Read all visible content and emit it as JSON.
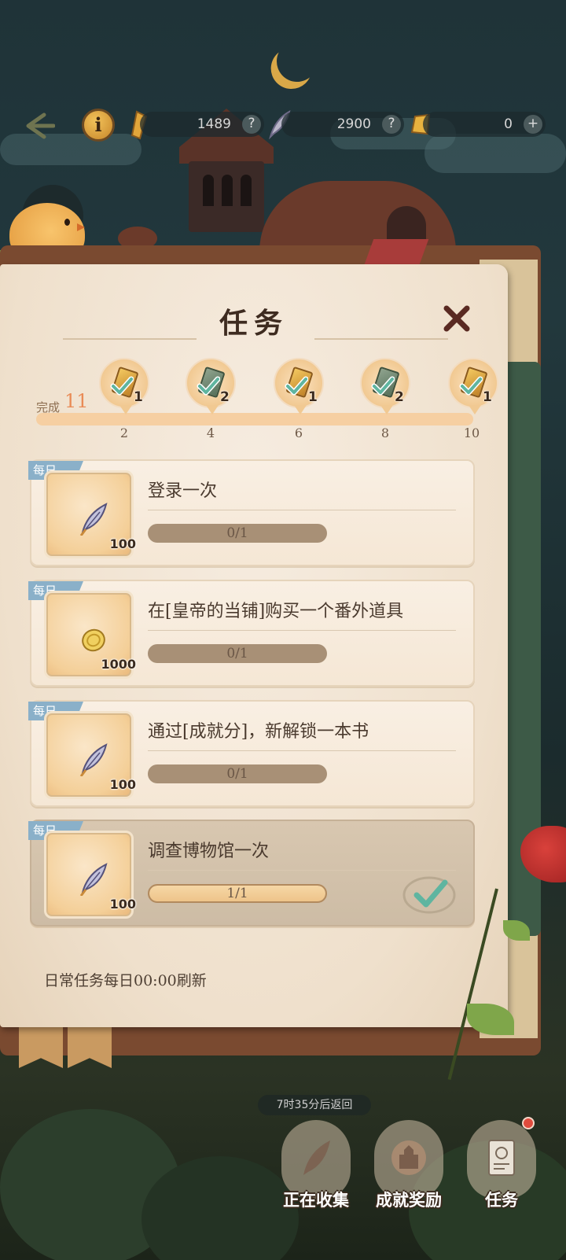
{
  "hud": {
    "info_label": "i",
    "resources": [
      {
        "name": "gold-quill",
        "value": "1489",
        "action": "?"
      },
      {
        "name": "feather",
        "value": "2900",
        "action": "?"
      },
      {
        "name": "coin",
        "value": "0",
        "action": "+"
      }
    ]
  },
  "panel": {
    "title": "任务",
    "progress": {
      "done_label": "完成",
      "done_count": "11",
      "fill_fraction": 1.0,
      "ticks": [
        "2",
        "4",
        "6",
        "8",
        "10"
      ],
      "milestones": [
        {
          "reward": "gold-book",
          "qty": "1",
          "claimed": true
        },
        {
          "reward": "green-book",
          "qty": "2",
          "claimed": true
        },
        {
          "reward": "gold-book",
          "qty": "1",
          "claimed": true
        },
        {
          "reward": "green-book",
          "qty": "2",
          "claimed": true
        },
        {
          "reward": "gold-book",
          "qty": "1",
          "claimed": true
        }
      ]
    },
    "tasks": [
      {
        "tag": "每日",
        "name": "登录一次",
        "reward_icon": "feather-icon",
        "reward_amount": "100",
        "progress_text": "0/1",
        "progress": 0,
        "done": false
      },
      {
        "tag": "每日",
        "name": "在[皇帝的当铺]购买一个番外道具",
        "reward_icon": "coin-icon",
        "reward_amount": "1000",
        "progress_text": "0/1",
        "progress": 0,
        "done": false
      },
      {
        "tag": "每日",
        "name": "通过[成就分]，新解锁一本书",
        "reward_icon": "feather-icon",
        "reward_amount": "100",
        "progress_text": "0/1",
        "progress": 0,
        "done": false
      },
      {
        "tag": "每日",
        "name": "调查博物馆一次",
        "reward_icon": "feather-icon",
        "reward_amount": "100",
        "progress_text": "1/1",
        "progress": 1,
        "done": true
      }
    ],
    "refresh_note": "日常任务每日00:00刷新"
  },
  "bottom_nav": {
    "return_timer": "7时35分后返回",
    "items": [
      {
        "label": "正在收集",
        "icon": "quill-icon"
      },
      {
        "label": "成就奖励",
        "icon": "castle-seal-icon"
      },
      {
        "label": "任务",
        "icon": "task-book-icon",
        "badge": true
      }
    ]
  },
  "colors": {
    "accent_orange": "#e98b56",
    "daily_tag": "#8ab0c9",
    "check_teal": "#5fb5a0",
    "panel_bg": "#f3e6d4"
  }
}
